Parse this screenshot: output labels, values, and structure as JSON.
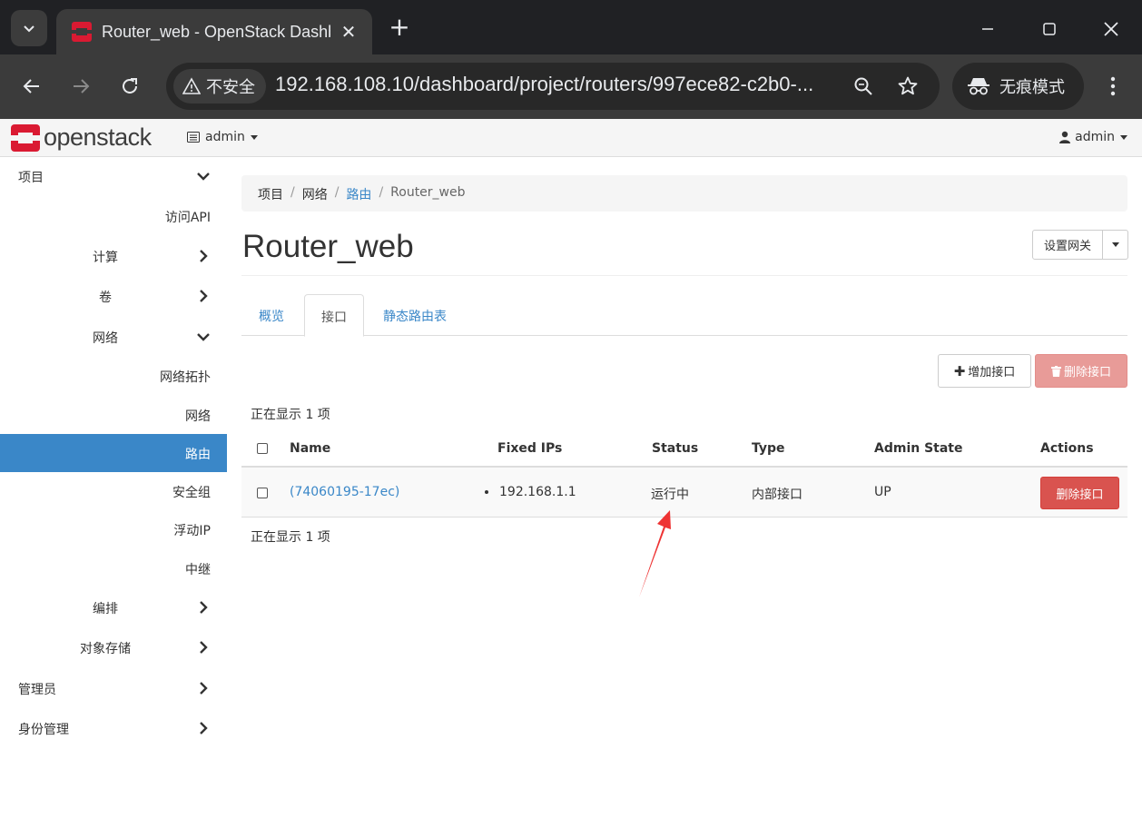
{
  "browser": {
    "tab_title": "Router_web - OpenStack Dashboard",
    "insecure_label": "不安全",
    "url": "192.168.108.10/dashboard/project/routers/997ece82-c2b0-...",
    "incognito_label": "无痕模式"
  },
  "header": {
    "logo_text": "openstack",
    "project": "admin",
    "user": "admin"
  },
  "sidebar": {
    "items": [
      {
        "label": "项目"
      },
      {
        "label": "访问API"
      },
      {
        "label": "计算"
      },
      {
        "label": "卷"
      },
      {
        "label": "网络"
      },
      {
        "label": "网络拓扑"
      },
      {
        "label": "网络"
      },
      {
        "label": "路由"
      },
      {
        "label": "安全组"
      },
      {
        "label": "浮动IP"
      },
      {
        "label": "中继"
      },
      {
        "label": "编排"
      },
      {
        "label": "对象存储"
      },
      {
        "label": "管理员"
      },
      {
        "label": "身份管理"
      }
    ]
  },
  "breadcrumb": {
    "items": [
      "项目",
      "网络",
      "路由",
      "Router_web"
    ]
  },
  "page": {
    "title": "Router_web",
    "gateway_button": "设置网关"
  },
  "tabs": [
    "概览",
    "接口",
    "静态路由表"
  ],
  "actions": {
    "add_interface": "增加接口",
    "delete_interfaces": "删除接口"
  },
  "table": {
    "count_text": "正在显示 1 项",
    "columns": [
      "Name",
      "Fixed IPs",
      "Status",
      "Type",
      "Admin State",
      "Actions"
    ],
    "rows": [
      {
        "name": "(74060195-17ec)",
        "fixed_ip": "192.168.1.1",
        "status": "运行中",
        "type": "内部接口",
        "admin_state": "UP",
        "action": "删除接口"
      }
    ]
  },
  "colors": {
    "accent": "#3a87c8",
    "danger": "#d9534f",
    "danger_disabled": "#e89b98",
    "logo_red": "#da1a32",
    "annotation_arrow": "#ee3333"
  }
}
